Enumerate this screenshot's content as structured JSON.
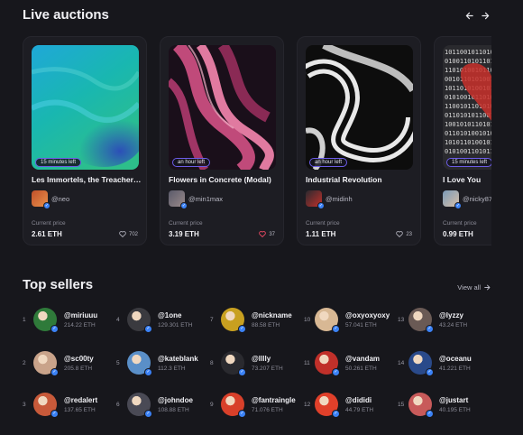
{
  "live_auctions": {
    "title": "Live auctions",
    "cards": [
      {
        "title": "Les Immortels, the Treacherous",
        "time_left": "15 minutes left",
        "owner": "@neo",
        "price_label": "Current price",
        "price": "2.61 ETH",
        "likes": "702",
        "liked": false,
        "art": "blue-water"
      },
      {
        "title": "Flowers in Concrete (Modal)",
        "time_left": "an hour left",
        "owner": "@min1max",
        "price_label": "Current price",
        "price": "3.19 ETH",
        "likes": "37",
        "liked": true,
        "art": "pink-flow"
      },
      {
        "title": "Industrial Revolution",
        "time_left": "an hour left",
        "owner": "@midinh",
        "price_label": "Current price",
        "price": "1.11 ETH",
        "likes": "23",
        "liked": false,
        "art": "bw-swirl"
      },
      {
        "title": "I Love You",
        "time_left": "15 minutes left",
        "owner": "@nicky87",
        "price_label": "Current price",
        "price": "0.99 ETH",
        "likes": "",
        "liked": false,
        "art": "binary-heart"
      }
    ]
  },
  "top_sellers": {
    "title": "Top sellers",
    "view_all": "View all",
    "sellers": [
      {
        "rank": "1",
        "name": "@miriuuu",
        "amount": "214.22 ETH",
        "color": "#2f7a3a"
      },
      {
        "rank": "2",
        "name": "@sc00ty",
        "amount": "205.8 ETH",
        "color": "#c9a38a"
      },
      {
        "rank": "3",
        "name": "@redalert",
        "amount": "137.65 ETH",
        "color": "#c85a3a"
      },
      {
        "rank": "4",
        "name": "@1one",
        "amount": "129.301 ETH",
        "color": "#3a3a3f"
      },
      {
        "rank": "5",
        "name": "@kateblank",
        "amount": "112.3 ETH",
        "color": "#5a8fc8"
      },
      {
        "rank": "6",
        "name": "@johndoe",
        "amount": "108.88 ETH",
        "color": "#4a4a55"
      },
      {
        "rank": "7",
        "name": "@nickname",
        "amount": "88.58 ETH",
        "color": "#c8a020"
      },
      {
        "rank": "8",
        "name": "@lllly",
        "amount": "73.207 ETH",
        "color": "#2a2a2f"
      },
      {
        "rank": "9",
        "name": "@fantraingle",
        "amount": "71.076 ETH",
        "color": "#d8402a"
      },
      {
        "rank": "10",
        "name": "@oxyoxyoxy",
        "amount": "57.041 ETH",
        "color": "#d8b894"
      },
      {
        "rank": "11",
        "name": "@vandam",
        "amount": "50.261 ETH",
        "color": "#c0302a"
      },
      {
        "rank": "12",
        "name": "@dididi",
        "amount": "44.79 ETH",
        "color": "#e0402a"
      },
      {
        "rank": "13",
        "name": "@lyzzy",
        "amount": "43.24 ETH",
        "color": "#6a5a55"
      },
      {
        "rank": "14",
        "name": "@oceanu",
        "amount": "41.221 ETH",
        "color": "#2a4a8a"
      },
      {
        "rank": "15",
        "name": "@justart",
        "amount": "40.195 ETH",
        "color": "#c85a5a"
      }
    ]
  },
  "colors": {
    "background": "#17171c",
    "card": "#1d1d23",
    "badge_border": "#6c5ce7",
    "verified": "#3b82f6",
    "liked": "#ff4d6a"
  }
}
